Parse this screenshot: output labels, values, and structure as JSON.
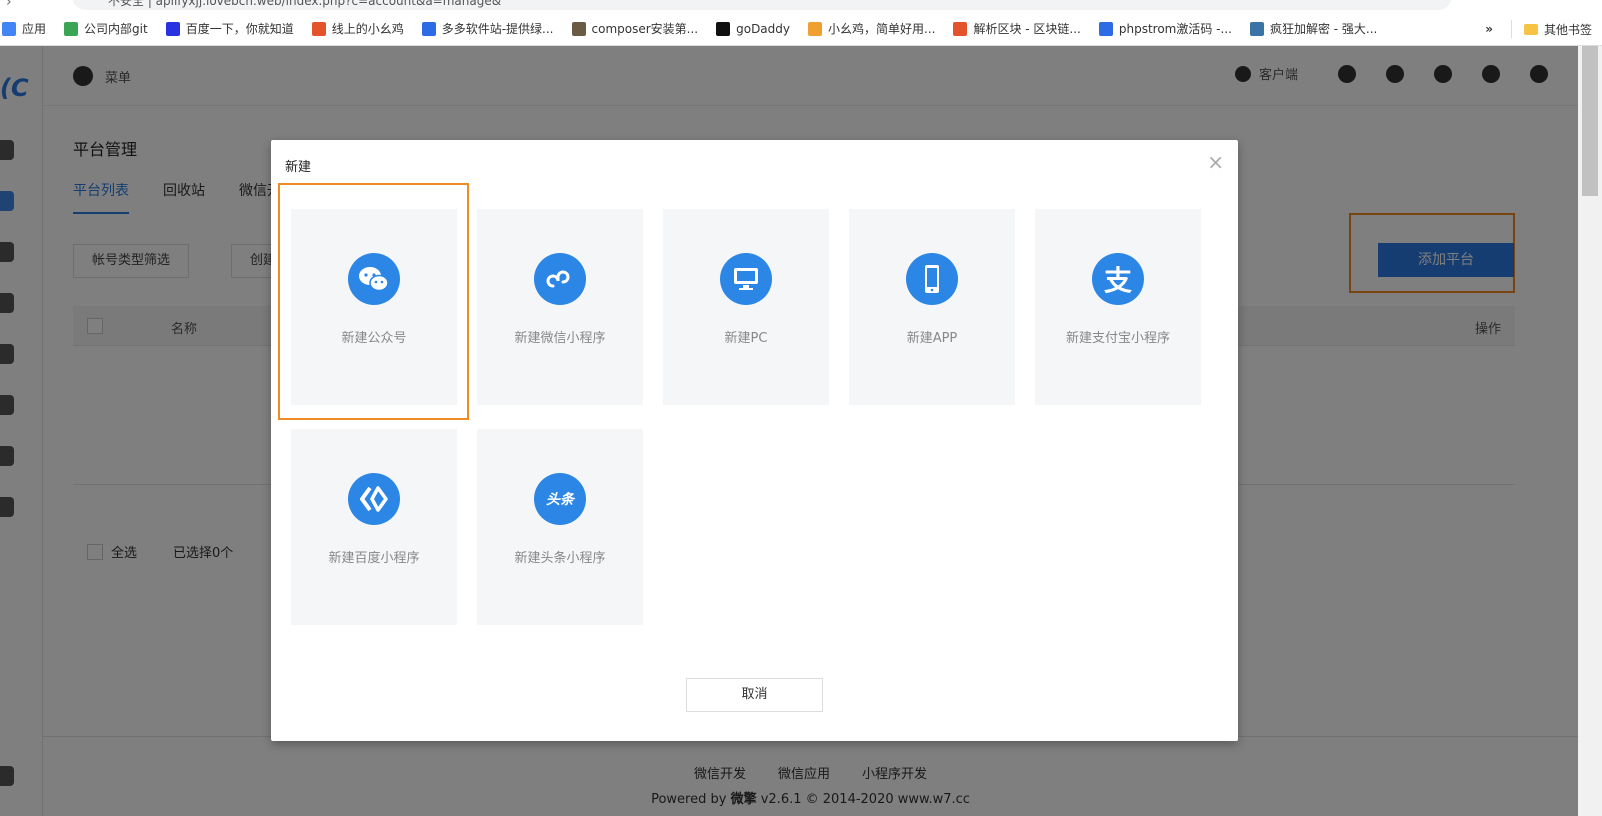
{
  "browser": {
    "address": "不安全 | apiifyxjj.lovebch.web/index.php?c=account&a=manage&",
    "bookmarks": [
      {
        "label": "应用",
        "icon": "apps-icon",
        "color": "#4285f4"
      },
      {
        "label": "公司内部git",
        "icon": "git-icon",
        "color": "#3aa655"
      },
      {
        "label": "百度一下，你就知道",
        "icon": "baidu-icon",
        "color": "#2932e1"
      },
      {
        "label": "线上的小幺鸡",
        "icon": "doc-icon",
        "color": "#e5532d"
      },
      {
        "label": "多多软件站-提供绿...",
        "icon": "d-icon",
        "color": "#2d6be4"
      },
      {
        "label": "composer安装第...",
        "icon": "composer-icon",
        "color": "#6b5b45"
      },
      {
        "label": "goDaddy",
        "icon": "godaddy-icon",
        "color": "#111111"
      },
      {
        "label": "小幺鸡，简单好用...",
        "icon": "chick-icon",
        "color": "#f0a030"
      },
      {
        "label": "解析区块 - 区块链...",
        "icon": "doc-icon",
        "color": "#e5532d"
      },
      {
        "label": "phpstrom激活码 -...",
        "icon": "php-icon",
        "color": "#2d6be4"
      },
      {
        "label": "疯狂加解密 - 强大...",
        "icon": "python-icon",
        "color": "#3a74a6"
      }
    ],
    "more": "»",
    "other_bookmarks": "其他书签"
  },
  "topbar": {
    "menu_label": "菜单",
    "client_label": "客户端"
  },
  "page": {
    "title": "平台管理",
    "tabs": [
      "平台列表",
      "回收站",
      "微信开"
    ],
    "filter_label": "帐号类型筛选",
    "filter2_label": "创建",
    "add_button": "添加平台",
    "col_name": "名称",
    "col_op": "操作",
    "select_all": "全选",
    "selected_count": "已选择0个"
  },
  "footer": {
    "links": [
      "微信开发",
      "微信应用",
      "小程序开发"
    ],
    "powered_prefix": "Powered by",
    "brand": "微擎",
    "powered_suffix": "v2.6.1 © 2014-2020 www.w7.cc"
  },
  "modal": {
    "title": "新建",
    "close": "×",
    "cards": [
      {
        "label": "新建公众号",
        "icon": "wechat-icon"
      },
      {
        "label": "新建微信小程序",
        "icon": "mini-program-icon"
      },
      {
        "label": "新建PC",
        "icon": "monitor-icon"
      },
      {
        "label": "新建APP",
        "icon": "phone-icon"
      },
      {
        "label": "新建支付宝小程序",
        "icon": "alipay-icon",
        "glyph": "支"
      },
      {
        "label": "新建百度小程序",
        "icon": "baidu-smart-icon"
      },
      {
        "label": "新建头条小程序",
        "icon": "toutiao-icon",
        "glyph": "头条"
      }
    ],
    "cancel": "取消"
  },
  "colors": {
    "accent": "#2c86e6",
    "highlight": "#f08a24",
    "card_bg": "#f5f6f8"
  }
}
